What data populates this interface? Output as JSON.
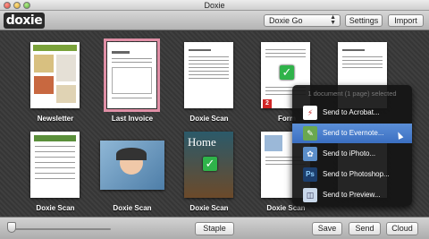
{
  "window": {
    "title": "Doxie"
  },
  "toolbar": {
    "logo": "doxie",
    "device_select": "Doxie Go",
    "settings_label": "Settings",
    "import_label": "Import"
  },
  "scans": [
    {
      "caption": "Newsletter"
    },
    {
      "caption": "Last Invoice"
    },
    {
      "caption": "Doxie Scan"
    },
    {
      "caption": "Form",
      "badge": "2"
    },
    {
      "caption": ""
    },
    {
      "caption": "Doxie Scan"
    },
    {
      "caption": "Doxie Scan"
    },
    {
      "caption": "Doxie Scan",
      "photo_text": "Home"
    },
    {
      "caption": "Doxie Scan"
    },
    {
      "caption": ""
    }
  ],
  "send_menu": {
    "header": "1 document (1 page) selected",
    "items": [
      {
        "label": "Send to Acrobat...",
        "icon": "acrobat-icon"
      },
      {
        "label": "Send to Evernote...",
        "icon": "evernote-icon"
      },
      {
        "label": "Send to iPhoto...",
        "icon": "iphoto-icon"
      },
      {
        "label": "Send to Photoshop...",
        "icon": "photoshop-icon",
        "glyph": "Ps"
      },
      {
        "label": "Send to Preview...",
        "icon": "preview-icon"
      }
    ]
  },
  "bottom": {
    "staple_label": "Staple",
    "save_label": "Save",
    "send_label": "Send",
    "cloud_label": "Cloud"
  },
  "colors": {
    "selection_outline": "#e08fa6",
    "menu_highlight": "#4a7fcf",
    "check_green": "#2fb34a",
    "badge_red": "#d02626"
  }
}
